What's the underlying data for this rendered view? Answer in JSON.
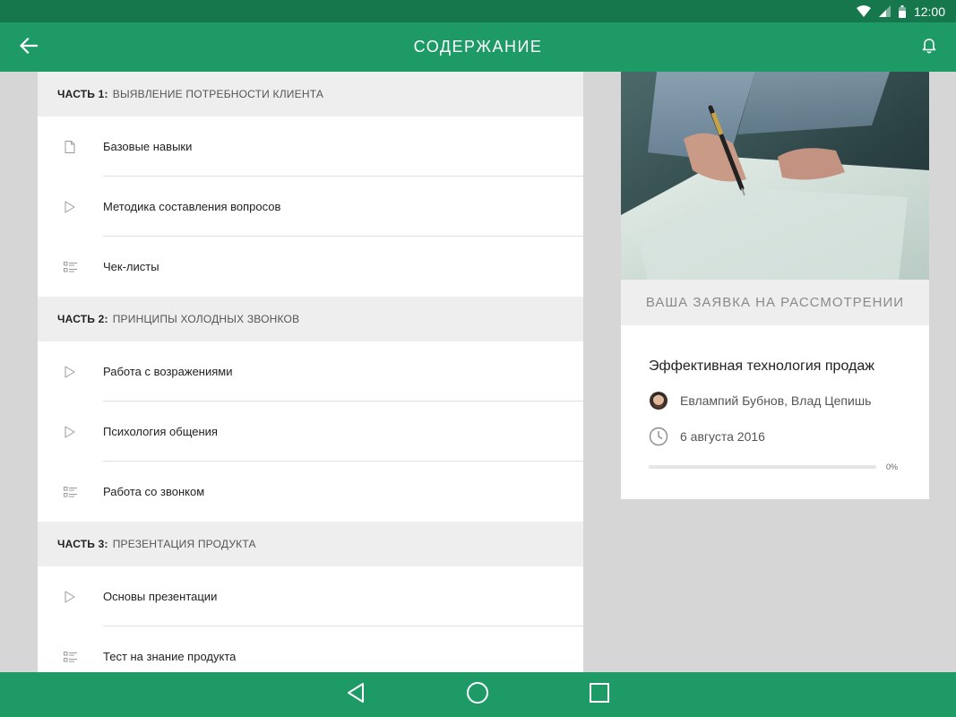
{
  "status_bar": {
    "time": "12:00"
  },
  "app_bar": {
    "title": "СОДЕРЖАНИЕ"
  },
  "sections": [
    {
      "number": "ЧАСТЬ 1:",
      "title": "ВЫЯВЛЕНИЕ ПОТРЕБНОСТИ КЛИЕНТА",
      "items": [
        {
          "icon": "document-icon",
          "label": "Базовые навыки"
        },
        {
          "icon": "play-icon",
          "label": "Методика составления вопросов"
        },
        {
          "icon": "checklist-icon",
          "label": "Чек-листы"
        }
      ]
    },
    {
      "number": "ЧАСТЬ 2:",
      "title": "ПРИНЦИПЫ ХОЛОДНЫХ ЗВОНКОВ",
      "items": [
        {
          "icon": "play-icon",
          "label": "Работа с возражениями"
        },
        {
          "icon": "play-icon",
          "label": "Психология общения"
        },
        {
          "icon": "checklist-icon",
          "label": "Работа со звонком"
        }
      ]
    },
    {
      "number": "ЧАСТЬ 3:",
      "title": "ПРЕЗЕНТАЦИЯ ПРОДУКТА",
      "items": [
        {
          "icon": "play-icon",
          "label": "Основы презентации"
        },
        {
          "icon": "checklist-icon",
          "label": "Тест на знание продукта"
        }
      ]
    }
  ],
  "course": {
    "status": "ВАША ЗАЯВКА НА РАССМОТРЕНИИ",
    "title": "Эффективная технология продаж",
    "authors": "Евлампий Бубнов, Влад Цепишь",
    "date": "6 августа 2016",
    "progress_percent": 0,
    "progress_label": "0%"
  },
  "colors": {
    "primary": "#1e9a67",
    "primary_dark": "#16764c"
  }
}
